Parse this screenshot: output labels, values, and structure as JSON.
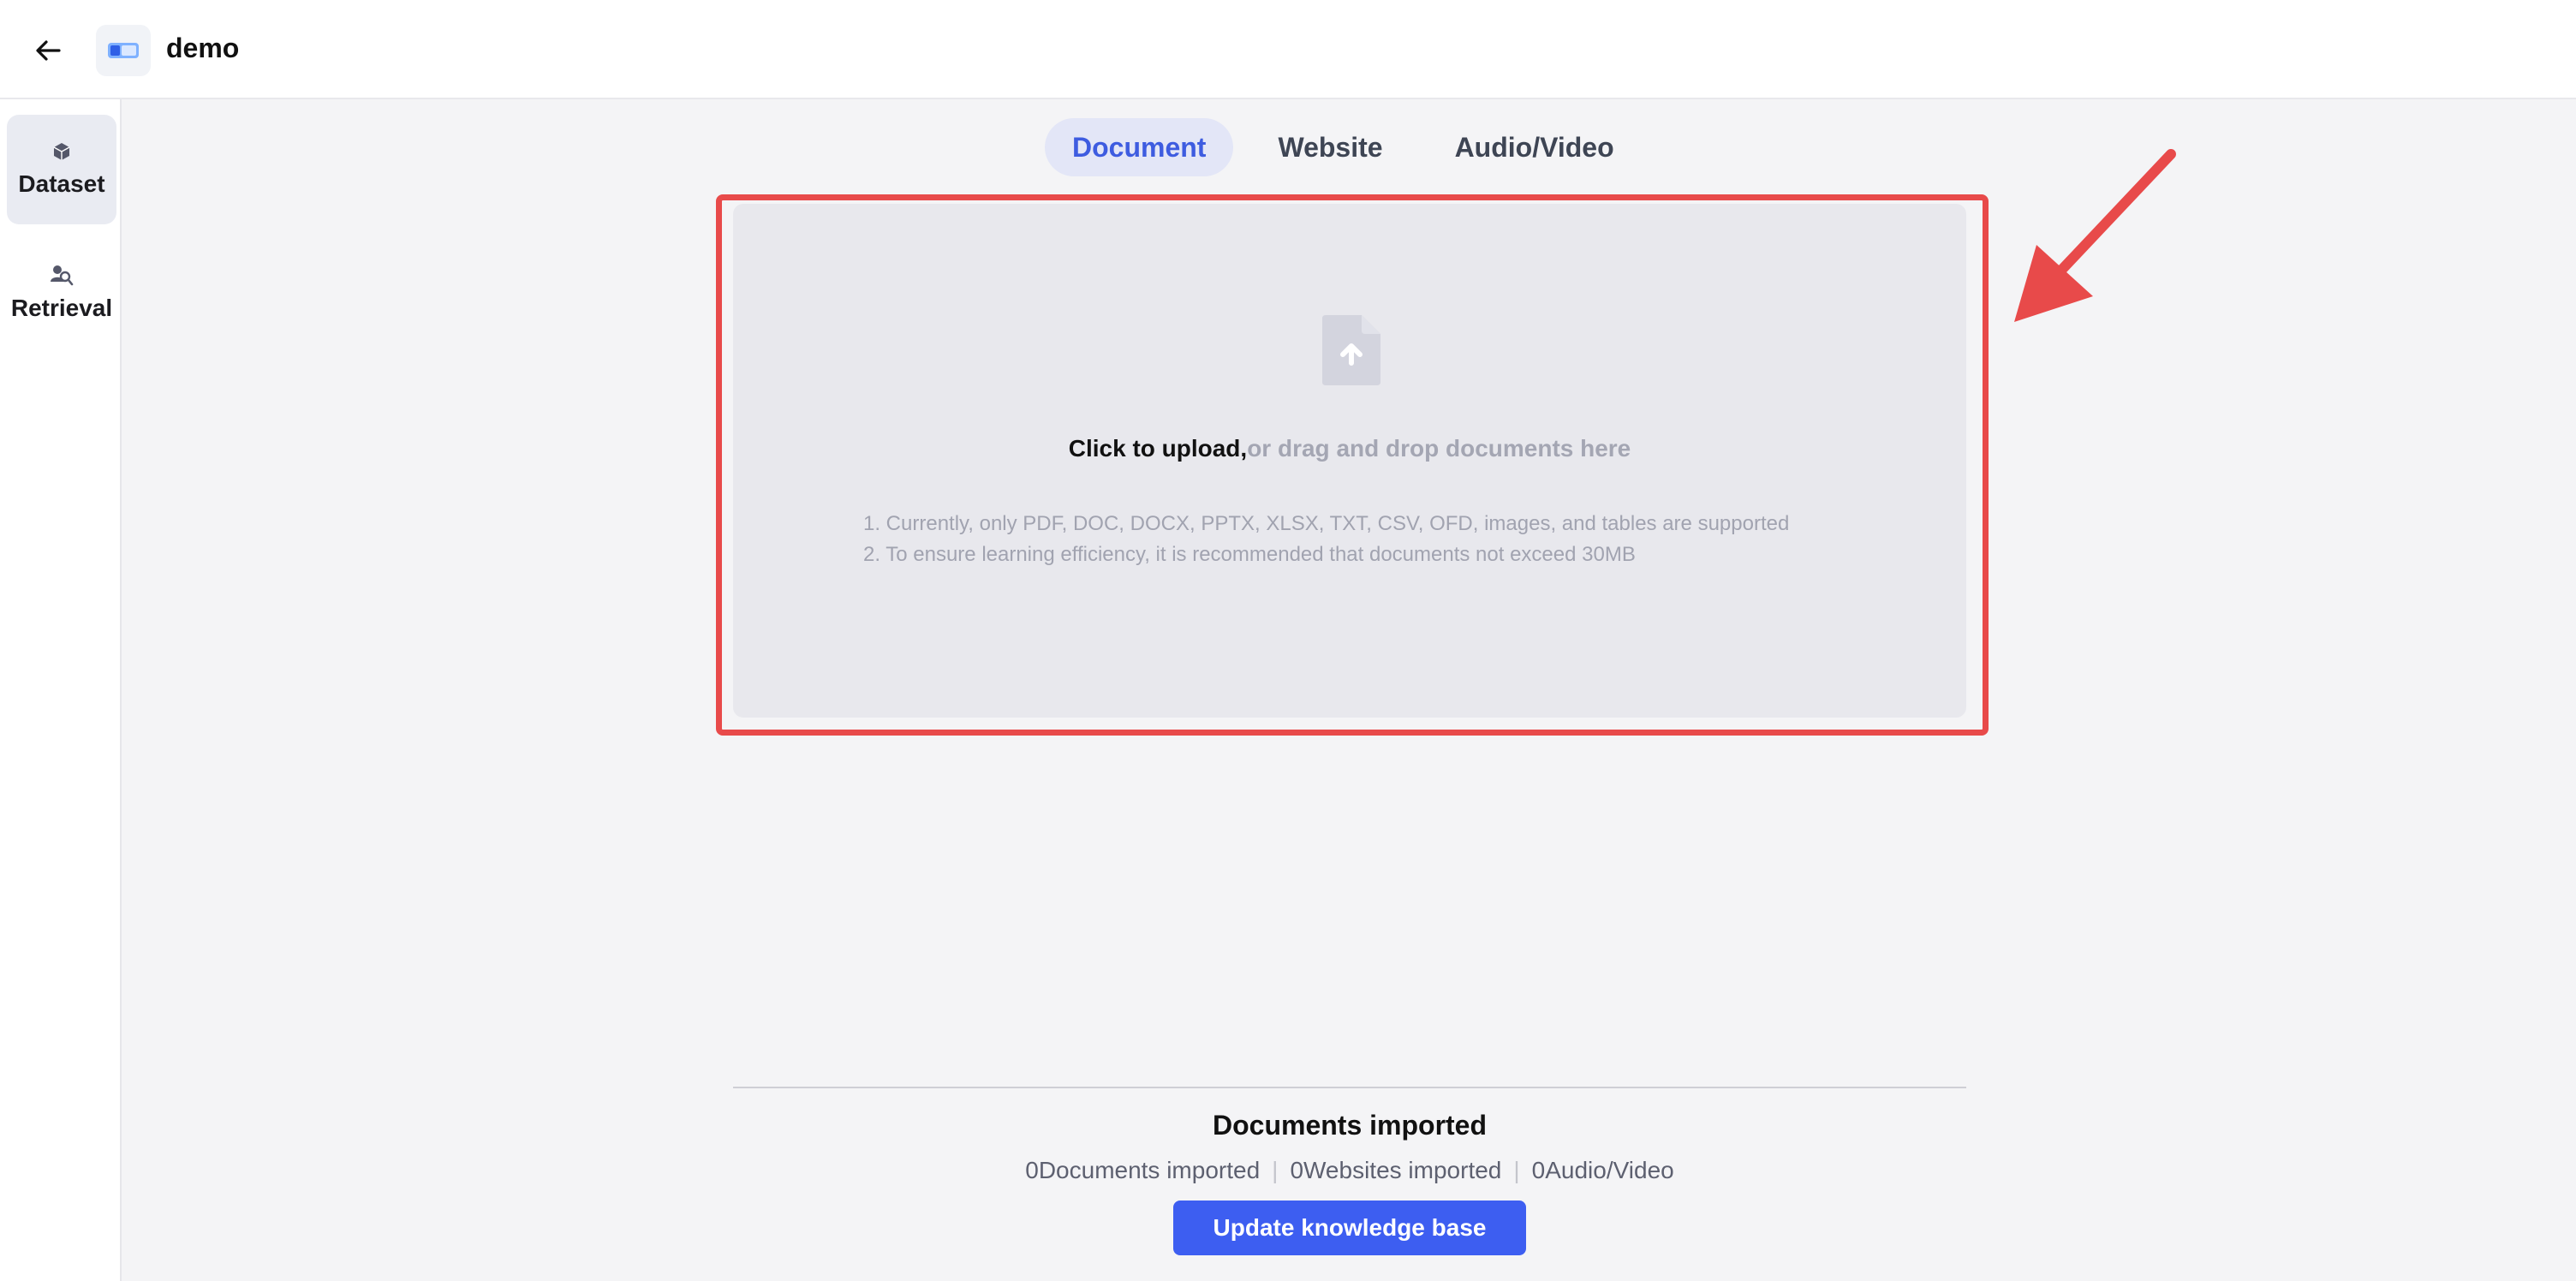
{
  "header": {
    "title": "demo",
    "back_icon": "arrow-left-icon",
    "logo_icon": "dataset-logo-icon"
  },
  "sidebar": {
    "items": [
      {
        "label": "Dataset",
        "icon": "cube-icon",
        "active": true
      },
      {
        "label": "Retrieval",
        "icon": "search-people-icon",
        "active": false
      }
    ]
  },
  "tabs": [
    {
      "label": "Document",
      "active": true
    },
    {
      "label": "Website",
      "active": false
    },
    {
      "label": "Audio/Video",
      "active": false
    }
  ],
  "upload": {
    "icon": "file-upload-icon",
    "click_text": "Click to upload,",
    "drag_text": "or drag and drop documents here",
    "hints": [
      "1. Currently, only PDF, DOC, DOCX, PPTX, XLSX, TXT, CSV, OFD, images, and tables are supported",
      "2. To ensure learning efficiency, it is recommended that documents not exceed 30MB"
    ]
  },
  "annotation": {
    "frame_color": "#e84a4a",
    "arrow_color": "#e84a4a"
  },
  "summary": {
    "title": "Documents imported",
    "stats": [
      "0Documents imported",
      "0Websites imported",
      "0Audio/Video"
    ]
  },
  "actions": {
    "update_label": "Update knowledge base"
  },
  "colors": {
    "accent": "#3d5ef1",
    "tab_active_text": "#3e5ce0",
    "tab_active_bg": "#e3e6f7"
  }
}
